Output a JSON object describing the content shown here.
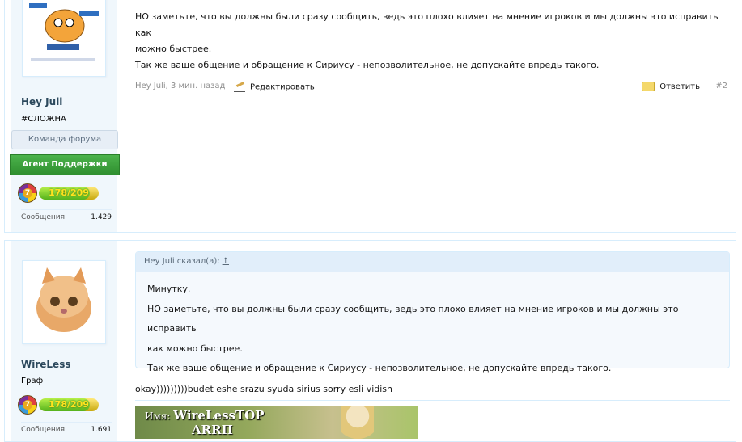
{
  "post1": {
    "username": "Hey Juli",
    "usertitle": "#СЛОЖНА",
    "banner_team": "Команда форума",
    "banner_agent": "Агент Поддержки",
    "level": {
      "badge": "7",
      "text": "178/209",
      "progress": 0.85
    },
    "messages_label": "Сообщения:",
    "messages_count": "1.429",
    "text_lines": [
      "НО заметьте, что вы должны были сразу сообщить, ведь это плохо влияет на мнение игроков и мы должны это исправить как",
      "можно быстрее.",
      "Так же ваще общение и обращение к Сириусу - непозволительное, не допускайте впредь такого."
    ],
    "meta": {
      "author_time": "Hey Juli, 3 мин. назад",
      "edit_label": "Редактировать",
      "reply_label": "Ответить",
      "post_number": "#2"
    }
  },
  "post2": {
    "username": "WireLess",
    "usertitle": "Граф",
    "level": {
      "badge": "7",
      "text": "178/209",
      "progress": 0.85
    },
    "messages_label": "Сообщения:",
    "messages_count": "1.691",
    "quote": {
      "header": "Hey Juli сказал(а):",
      "up_link": "↑",
      "lines": [
        "Минутку.",
        "НО заметьте, что вы должны были сразу сообщить, ведь это плохо влияет на мнение игроков и мы должны это исправить",
        "как можно быстрее.",
        "Так же ваще общение и обращение к Сириусу - непозволительное, не допускайте впредь такого."
      ]
    },
    "reply_text": "okay)))))))))budet eshe srazu syuda sirius sorry esli vidish",
    "signature": {
      "name_label": "Имя:",
      "name_value": "WireLessTOP",
      "second_value": "ARRП"
    }
  },
  "colors": {
    "accent": "#2b485c",
    "border": "#d7edfc",
    "sidebar_bg": "#f0f7fc",
    "agent_green": "#3a9f3a"
  }
}
